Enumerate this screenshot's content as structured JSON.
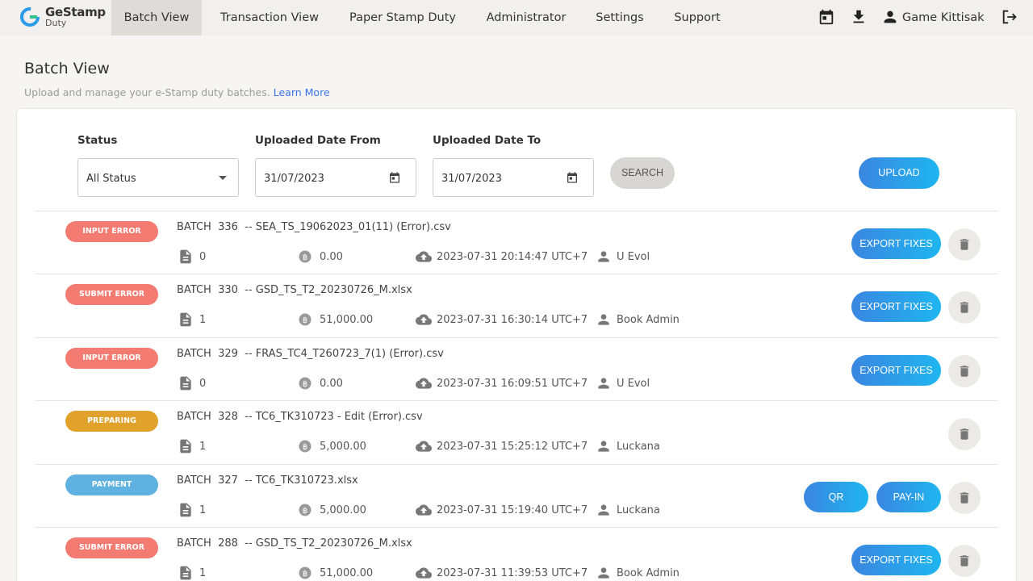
{
  "app": {
    "logo_name": "GeStamp",
    "logo_sub": "Duty",
    "nav": [
      {
        "label": "Batch View"
      },
      {
        "label": "Transaction View"
      },
      {
        "label": "Paper Stamp Duty"
      },
      {
        "label": "Administrator"
      },
      {
        "label": "Settings"
      },
      {
        "label": "Support"
      }
    ],
    "user_name": "Game Kittisak"
  },
  "page": {
    "title": "Batch View",
    "subtitle": "Upload and manage your e-Stamp duty batches.",
    "learn_more": "Learn More"
  },
  "filters": {
    "status_label": "Status",
    "status_value": "All Status",
    "from_label": "Uploaded Date From",
    "from_value": "31/07/2023",
    "to_label": "Uploaded Date To",
    "to_value": "31/07/2023",
    "search_label": "SEARCH",
    "upload_label": "UPLOAD"
  },
  "colors": {
    "input_error": "#f47b71",
    "submit_error": "#f47b71",
    "preparing": "#e0a22a",
    "payment": "#5fb1df",
    "accent": "#2a9be8"
  },
  "batches": [
    {
      "status": "INPUT ERROR",
      "name": "BATCH  336  -- SEA_TS_19062023_01(11) (Error).csv",
      "count": "0",
      "amount": "0.00",
      "uploaded": "2023-07-31 20:14:47 UTC+7",
      "user": "U Evol",
      "action": "EXPORT FIXES"
    },
    {
      "status": "SUBMIT ERROR",
      "name": "BATCH  330  -- GSD_TS_T2_20230726_M.xlsx",
      "count": "1",
      "amount": "51,000.00",
      "uploaded": "2023-07-31 16:30:14 UTC+7",
      "user": "Book Admin",
      "action": "EXPORT FIXES"
    },
    {
      "status": "INPUT ERROR",
      "name": "BATCH  329  -- FRAS_TC4_T260723_7(1) (Error).csv",
      "count": "0",
      "amount": "0.00",
      "uploaded": "2023-07-31 16:09:51 UTC+7",
      "user": "U Evol",
      "action": "EXPORT FIXES"
    },
    {
      "status": "PREPARING",
      "name": "BATCH  328  -- TC6_TK310723 - Edit (Error).csv",
      "count": "1",
      "amount": "5,000.00",
      "uploaded": "2023-07-31 15:25:12 UTC+7",
      "user": "Luckana"
    },
    {
      "status": "PAYMENT",
      "name": "BATCH  327  -- TC6_TK310723.xlsx",
      "count": "1",
      "amount": "5,000.00",
      "uploaded": "2023-07-31 15:19:40 UTC+7",
      "user": "Luckana",
      "action_qr": "QR",
      "action_payin": "PAY-IN"
    },
    {
      "status": "SUBMIT ERROR",
      "name": "BATCH  288  -- GSD_TS_T2_20230726_M.xlsx",
      "count": "1",
      "amount": "51,000.00",
      "uploaded": "2023-07-31 11:39:53 UTC+7",
      "user": "Book Admin",
      "action": "EXPORT FIXES"
    }
  ]
}
